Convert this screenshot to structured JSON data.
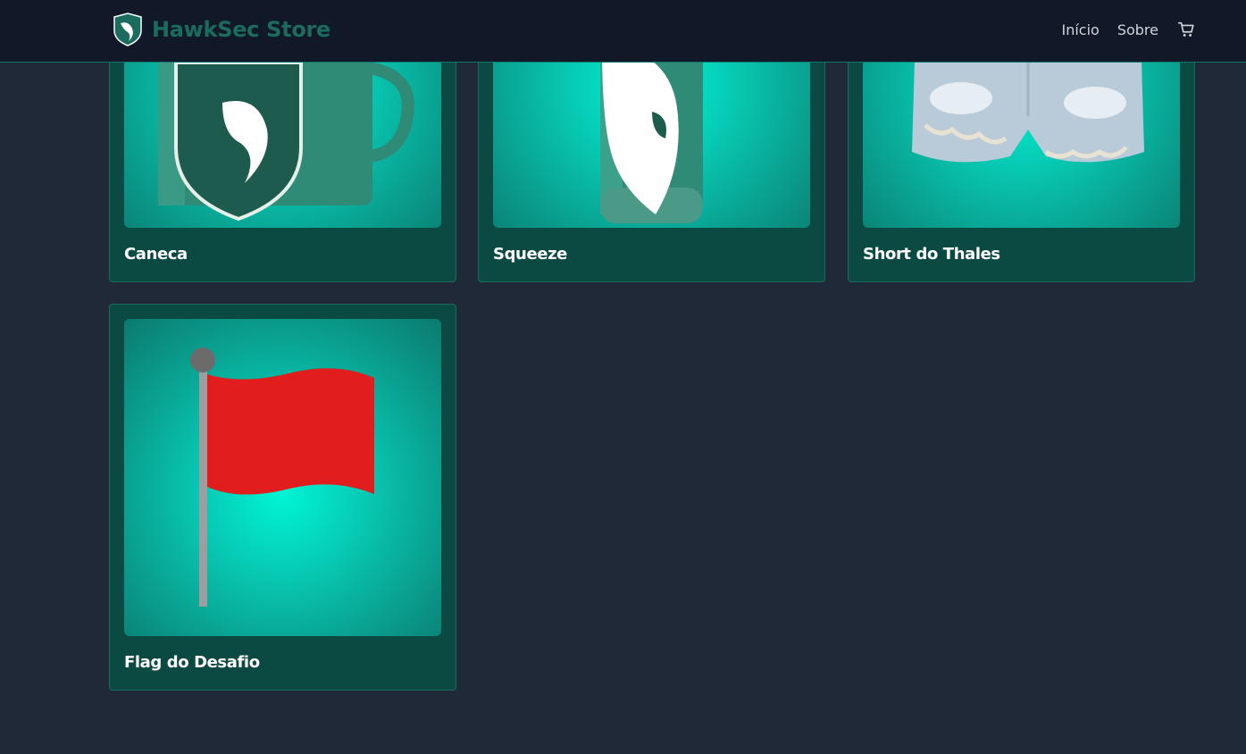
{
  "brand": {
    "name": "HawkSec Store",
    "logo_icon": "hawk-shield-icon"
  },
  "nav": {
    "links": [
      "Início",
      "Sobre"
    ],
    "cart_icon": "shopping-cart-icon"
  },
  "products": [
    {
      "name": "Caneca",
      "image": "mug-image"
    },
    {
      "name": "Squeeze",
      "image": "bottle-image"
    },
    {
      "name": "Short do Thales",
      "image": "shorts-image"
    },
    {
      "name": "Flag do Desafio",
      "image": "red-flag-image"
    }
  ],
  "colors": {
    "accent": "#1b6b5f",
    "card_bg": "#0b4a42",
    "page_bg": "#1f2937",
    "nav_bg": "#111827"
  }
}
